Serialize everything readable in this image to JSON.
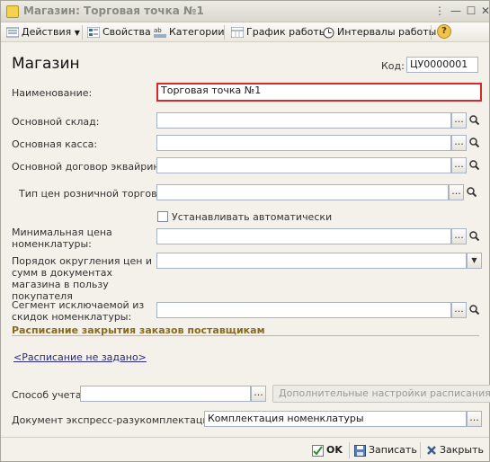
{
  "window": {
    "title": "Магазин: Торговая точка №1"
  },
  "toolbar": {
    "actions": "Действия",
    "properties": "Свойства",
    "categories": "Категории",
    "schedule": "График работы",
    "intervals": "Интервалы работы",
    "help": "?"
  },
  "form": {
    "heading": "Магазин",
    "code_label": "Код:",
    "code_value": "ЦУ0000001",
    "name_label": "Наименование:",
    "name_value": "Торговая точка №1",
    "warehouse_label": "Основной склад:",
    "warehouse_value": "",
    "cashbox_label": "Основная касса:",
    "cashbox_value": "",
    "acquiring_label": "Основной договор эквайринга:",
    "acquiring_value": "",
    "price_type_label": "Тип цен розничной торговли:",
    "price_type_value": "",
    "auto_label": "Устанавливать автоматически",
    "min_price_label": "Минимальная цена номенклатуры:",
    "min_price_value": "",
    "rounding_label": "Порядок округления цен и сумм в документах магазина в пользу покупателя",
    "rounding_value": "",
    "segment_label": "Сегмент исключаемой из скидок номенклатуры:",
    "segment_value": "",
    "section_title": "Расписание закрытия заказов поставщикам",
    "schedule_link": "<Расписание не задано>",
    "accounting_label": "Способ учета:",
    "accounting_value": "",
    "additional_settings": "Дополнительные настройки расписания ...",
    "express_label": "Документ экспресс-разукомплектации:",
    "express_value": "Комплектация номенклатуры"
  },
  "footer": {
    "ok": "OK",
    "save": "Записать",
    "close": "Закрыть"
  }
}
